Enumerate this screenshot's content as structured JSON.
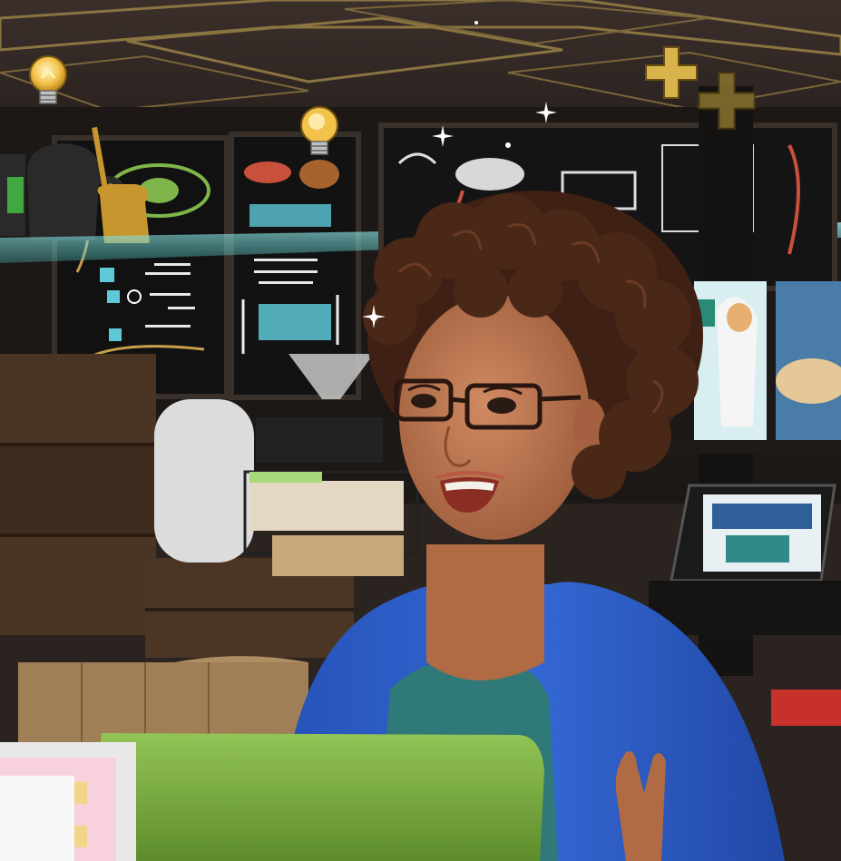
{
  "scene": {
    "description_colors": {
      "ceiling": "#3a2e2a",
      "ceiling_trim": "#8a7440",
      "wall": "#1f1b19",
      "chalkboard": "#121212",
      "chalk_cyan": "#5fc8d8",
      "chalk_green": "#7fb54a",
      "chalk_red": "#c8503c",
      "crate": "#4a3424",
      "skin": "#b8734e",
      "hair": "#3e2014",
      "cardigan": "#2f5fc8",
      "top": "#2f7a78",
      "laptop_green": "#7cae3e",
      "glass_shelf": "#7fe0e0"
    },
    "icons": [
      "lightbulb-icon",
      "lightbulb-icon",
      "plus-icon",
      "plus-icon",
      "sparkle-icon"
    ]
  }
}
